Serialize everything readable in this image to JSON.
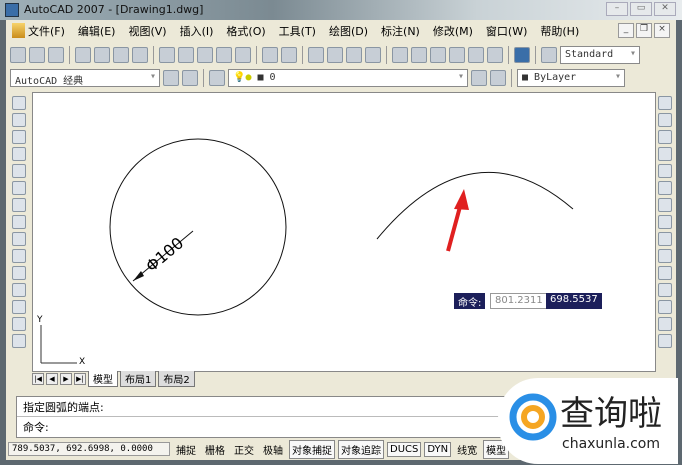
{
  "window": {
    "title": "AutoCAD 2007 - [Drawing1.dwg]"
  },
  "menu": [
    "文件(F)",
    "编辑(E)",
    "视图(V)",
    "插入(I)",
    "格式(O)",
    "工具(T)",
    "绘图(D)",
    "标注(N)",
    "修改(M)",
    "窗口(W)",
    "帮助(H)"
  ],
  "toolbar": {
    "text_style": "Standard",
    "workspace": "AutoCAD 经典",
    "layer": "0",
    "color": "ByLayer"
  },
  "drawing": {
    "dimension": "Φ100",
    "ucs_x": "X",
    "ucs_y": "Y"
  },
  "dynamic_input": {
    "label": "命令:",
    "x_value": "801.2311",
    "y_value": "698.5537"
  },
  "tabs": [
    "模型",
    "布局1",
    "布局2"
  ],
  "command": {
    "history": "指定圆弧的端点:",
    "prompt": "命令:"
  },
  "status": {
    "coords": "789.5037, 692.6998, 0.0000",
    "buttons": [
      "捕捉",
      "栅格",
      "正交",
      "极轴",
      "对象捕捉",
      "对象追踪",
      "DUCS",
      "DYN",
      "线宽",
      "模型"
    ]
  },
  "watermark": {
    "name": "查询啦",
    "url": "chaxunla.com"
  },
  "colors": {
    "arrow": "#e02020",
    "dyn_bg": "#1c1f5a"
  }
}
